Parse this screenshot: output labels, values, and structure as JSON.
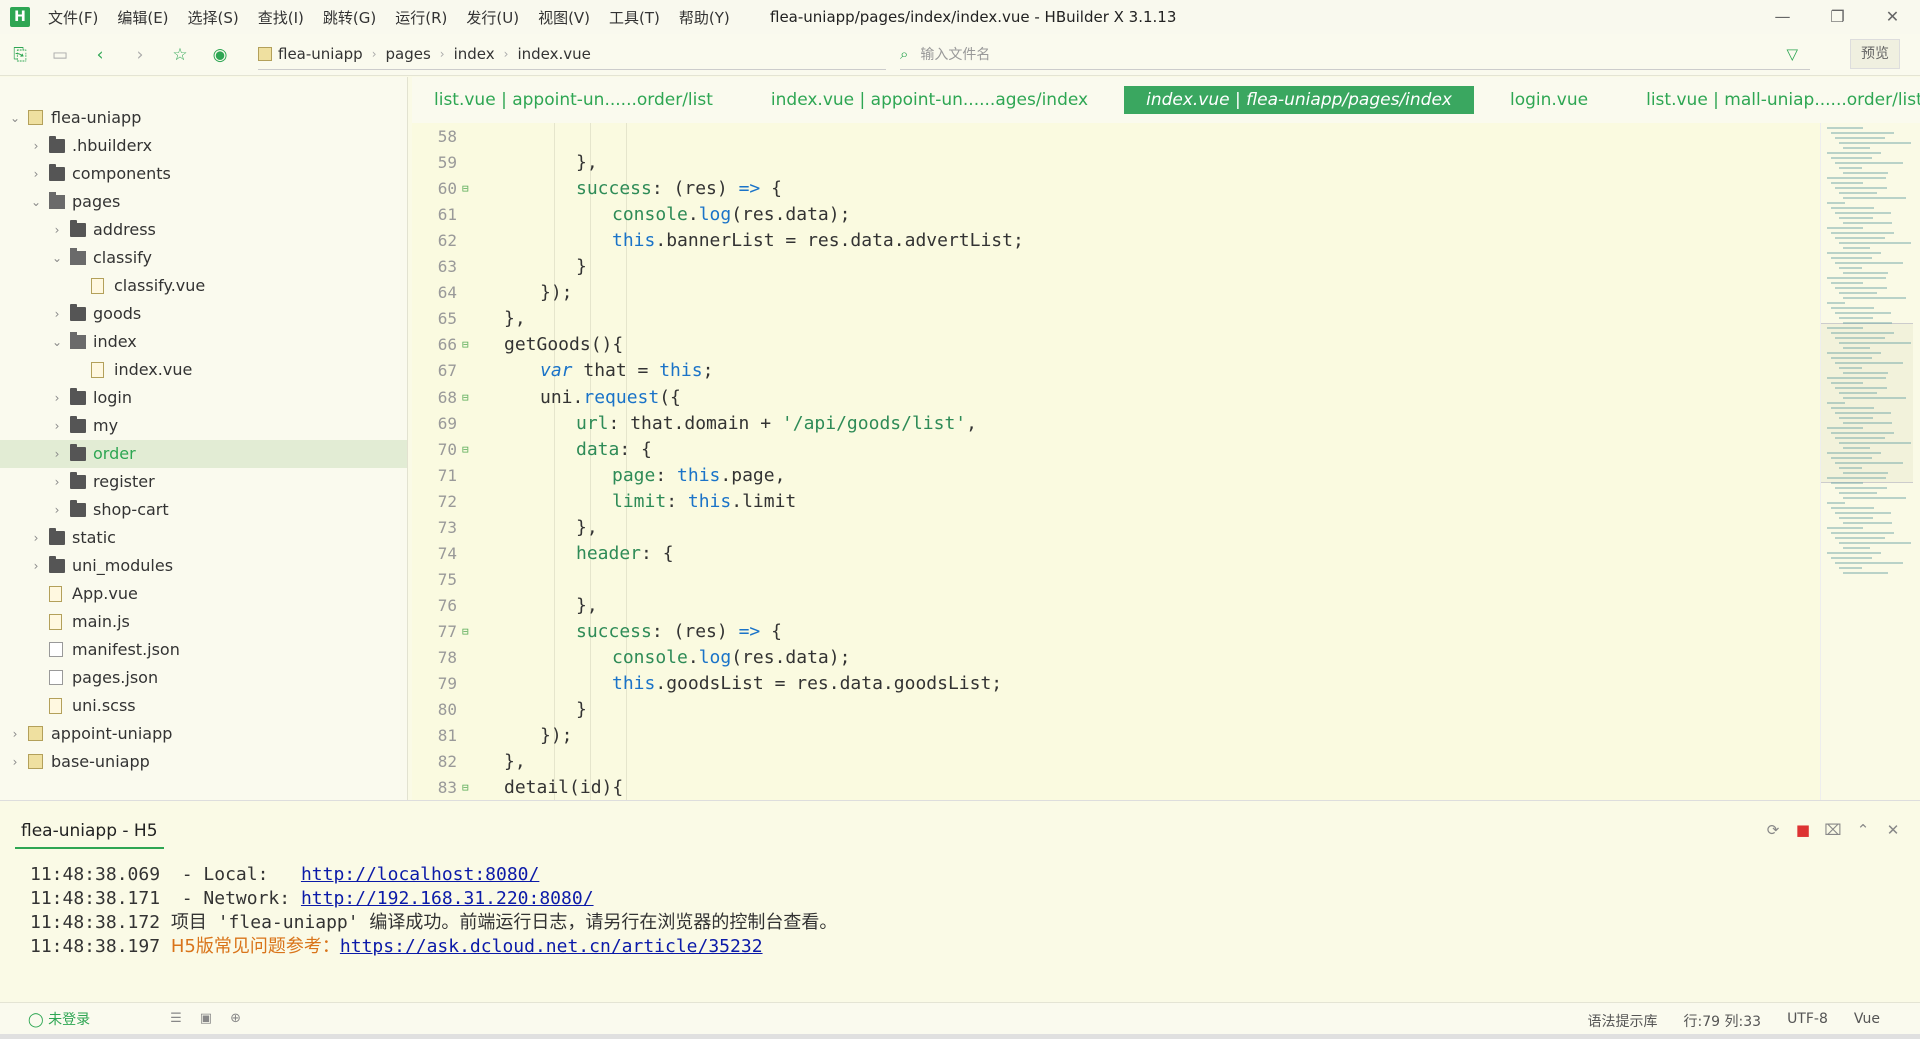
{
  "app": {
    "logo": "H",
    "title": "flea-uniapp/pages/index/index.vue - HBuilder X 3.1.13"
  },
  "menu": [
    "文件(F)",
    "编辑(E)",
    "选择(S)",
    "查找(I)",
    "跳转(G)",
    "运行(R)",
    "发行(U)",
    "视图(V)",
    "工具(T)",
    "帮助(Y)"
  ],
  "window_controls": {
    "minimize": "—",
    "maximize": "❐",
    "close": "✕"
  },
  "breadcrumb": [
    "flea-uniapp",
    "pages",
    "index",
    "index.vue"
  ],
  "search": {
    "placeholder": "输入文件名"
  },
  "preview_label": "预览",
  "tree": [
    {
      "label": "flea-uniapp",
      "level": 0,
      "type": "project",
      "arrow": "⌄"
    },
    {
      "label": ".hbuilderx",
      "level": 1,
      "type": "folder",
      "arrow": "›"
    },
    {
      "label": "components",
      "level": 1,
      "type": "folder",
      "arrow": "›"
    },
    {
      "label": "pages",
      "level": 1,
      "type": "folder-open",
      "arrow": "⌄"
    },
    {
      "label": "address",
      "level": 2,
      "type": "folder",
      "arrow": "›"
    },
    {
      "label": "classify",
      "level": 2,
      "type": "folder-open",
      "arrow": "⌄"
    },
    {
      "label": "classify.vue",
      "level": 3,
      "type": "file",
      "arrow": ""
    },
    {
      "label": "goods",
      "level": 2,
      "type": "folder",
      "arrow": "›"
    },
    {
      "label": "index",
      "level": 2,
      "type": "folder-open",
      "arrow": "⌄"
    },
    {
      "label": "index.vue",
      "level": 3,
      "type": "file",
      "arrow": ""
    },
    {
      "label": "login",
      "level": 2,
      "type": "folder",
      "arrow": "›"
    },
    {
      "label": "my",
      "level": 2,
      "type": "folder",
      "arrow": "›"
    },
    {
      "label": "order",
      "level": 2,
      "type": "folder",
      "arrow": "›",
      "selected": true
    },
    {
      "label": "register",
      "level": 2,
      "type": "folder",
      "arrow": "›"
    },
    {
      "label": "shop-cart",
      "level": 2,
      "type": "folder",
      "arrow": "›"
    },
    {
      "label": "static",
      "level": 1,
      "type": "folder",
      "arrow": "›"
    },
    {
      "label": "uni_modules",
      "level": 1,
      "type": "folder",
      "arrow": "›"
    },
    {
      "label": "App.vue",
      "level": 1,
      "type": "file",
      "arrow": ""
    },
    {
      "label": "main.js",
      "level": 1,
      "type": "file",
      "arrow": ""
    },
    {
      "label": "manifest.json",
      "level": 1,
      "type": "file-json",
      "arrow": ""
    },
    {
      "label": "pages.json",
      "level": 1,
      "type": "file-json",
      "arrow": ""
    },
    {
      "label": "uni.scss",
      "level": 1,
      "type": "file",
      "arrow": ""
    },
    {
      "label": "appoint-uniapp",
      "level": 0,
      "type": "project",
      "arrow": "›"
    },
    {
      "label": "base-uniapp",
      "level": 0,
      "type": "project",
      "arrow": "›"
    }
  ],
  "tabs": [
    {
      "label": "list.vue | appoint-un......order/list",
      "active": false
    },
    {
      "label": "index.vue | appoint-un......ages/index",
      "active": false
    },
    {
      "label": "index.vue | flea-uniapp/pages/index",
      "active": true
    },
    {
      "label": "login.vue",
      "active": false
    },
    {
      "label": "list.vue | mall-uniap......order/list",
      "active": false
    }
  ],
  "code": [
    {
      "ln": "58",
      "fold": "",
      "indent": 0,
      "tokens": []
    },
    {
      "ln": "59",
      "fold": "",
      "indent": 5,
      "tokens": [
        [
          "},",
          ""
        ]
      ]
    },
    {
      "ln": "60",
      "fold": "⊟",
      "indent": 5,
      "tokens": [
        [
          "success",
          "k-green"
        ],
        [
          ": (res) ",
          ""
        ],
        [
          "=>",
          "k-blue"
        ],
        [
          " {",
          ""
        ]
      ]
    },
    {
      "ln": "61",
      "fold": "",
      "indent": 6,
      "tokens": [
        [
          "console",
          "k-green"
        ],
        [
          ".",
          ""
        ],
        [
          "log",
          "k-blue"
        ],
        [
          "(res.data);",
          ""
        ]
      ]
    },
    {
      "ln": "62",
      "fold": "",
      "indent": 6,
      "tokens": [
        [
          "this",
          "k-blue"
        ],
        [
          ".bannerList = res.data.advertList;",
          ""
        ]
      ]
    },
    {
      "ln": "63",
      "fold": "",
      "indent": 5,
      "tokens": [
        [
          "}",
          ""
        ]
      ]
    },
    {
      "ln": "64",
      "fold": "",
      "indent": 4,
      "tokens": [
        [
          "});",
          ""
        ]
      ]
    },
    {
      "ln": "65",
      "fold": "",
      "indent": 3,
      "tokens": [
        [
          "},",
          ""
        ]
      ]
    },
    {
      "ln": "66",
      "fold": "⊟",
      "indent": 3,
      "tokens": [
        [
          "getGoods(){",
          ""
        ]
      ]
    },
    {
      "ln": "67",
      "fold": "",
      "indent": 4,
      "tokens": [
        [
          "var",
          "k-it"
        ],
        [
          " that = ",
          ""
        ],
        [
          "this",
          "k-blue"
        ],
        [
          ";",
          ""
        ]
      ]
    },
    {
      "ln": "68",
      "fold": "⊟",
      "indent": 4,
      "tokens": [
        [
          "uni",
          ""
        ],
        [
          ".",
          ""
        ],
        [
          "request",
          "k-blue"
        ],
        [
          "({",
          ""
        ]
      ]
    },
    {
      "ln": "69",
      "fold": "",
      "indent": 5,
      "tokens": [
        [
          "url",
          "k-green"
        ],
        [
          ": that.domain + ",
          ""
        ],
        [
          "'/api/goods/list'",
          "k-str"
        ],
        [
          ",",
          ""
        ]
      ]
    },
    {
      "ln": "70",
      "fold": "⊟",
      "indent": 5,
      "tokens": [
        [
          "data",
          "k-green"
        ],
        [
          ": {",
          ""
        ]
      ]
    },
    {
      "ln": "71",
      "fold": "",
      "indent": 6,
      "tokens": [
        [
          "page",
          "k-green"
        ],
        [
          ": ",
          ""
        ],
        [
          "this",
          "k-blue"
        ],
        [
          ".page,",
          ""
        ]
      ]
    },
    {
      "ln": "72",
      "fold": "",
      "indent": 6,
      "tokens": [
        [
          "limit",
          "k-green"
        ],
        [
          ": ",
          ""
        ],
        [
          "this",
          "k-blue"
        ],
        [
          ".limit",
          ""
        ]
      ]
    },
    {
      "ln": "73",
      "fold": "",
      "indent": 5,
      "tokens": [
        [
          "},",
          ""
        ]
      ]
    },
    {
      "ln": "74",
      "fold": "",
      "indent": 5,
      "tokens": [
        [
          "header",
          "k-green"
        ],
        [
          ": {",
          ""
        ]
      ]
    },
    {
      "ln": "75",
      "fold": "",
      "indent": 0,
      "tokens": []
    },
    {
      "ln": "76",
      "fold": "",
      "indent": 5,
      "tokens": [
        [
          "},",
          ""
        ]
      ]
    },
    {
      "ln": "77",
      "fold": "⊟",
      "indent": 5,
      "tokens": [
        [
          "success",
          "k-green"
        ],
        [
          ": (res) ",
          ""
        ],
        [
          "=>",
          "k-blue"
        ],
        [
          " {",
          ""
        ]
      ]
    },
    {
      "ln": "78",
      "fold": "",
      "indent": 6,
      "tokens": [
        [
          "console",
          "k-green"
        ],
        [
          ".",
          ""
        ],
        [
          "log",
          "k-blue"
        ],
        [
          "(res.data);",
          ""
        ]
      ]
    },
    {
      "ln": "79",
      "fold": "",
      "indent": 6,
      "tokens": [
        [
          "this",
          "k-blue"
        ],
        [
          ".goodsList = res.data.goodsList;",
          ""
        ]
      ]
    },
    {
      "ln": "80",
      "fold": "",
      "indent": 5,
      "tokens": [
        [
          "}",
          ""
        ]
      ]
    },
    {
      "ln": "81",
      "fold": "",
      "indent": 4,
      "tokens": [
        [
          "});",
          ""
        ]
      ]
    },
    {
      "ln": "82",
      "fold": "",
      "indent": 3,
      "tokens": [
        [
          "},",
          ""
        ]
      ]
    },
    {
      "ln": "83",
      "fold": "⊟",
      "indent": 3,
      "tokens": [
        [
          "detail(id){",
          ""
        ]
      ]
    }
  ],
  "console": {
    "tab_label": "flea-uniapp - H5",
    "lines": [
      {
        "time": "11:48:38.069",
        "text": "  - Local:   ",
        "link": "http://localhost:8080/",
        "orange": ""
      },
      {
        "time": "11:48:38.171",
        "text": "  - Network: ",
        "link": "http://192.168.31.220:8080/",
        "orange": ""
      },
      {
        "time": "11:48:38.172",
        "text": " 项目 'flea-uniapp' 编译成功。前端运行日志，请另行在浏览器的控制台查看。",
        "link": "",
        "orange": ""
      },
      {
        "time": "11:48:38.197",
        "text": " ",
        "link": "https://ask.dcloud.net.cn/article/35232",
        "orange": "H5版常见问题参考："
      }
    ]
  },
  "status": {
    "login": "未登录",
    "syntax_lib": "语法提示库",
    "position": "行:79  列:33",
    "encoding": "UTF-8",
    "language": "Vue"
  }
}
